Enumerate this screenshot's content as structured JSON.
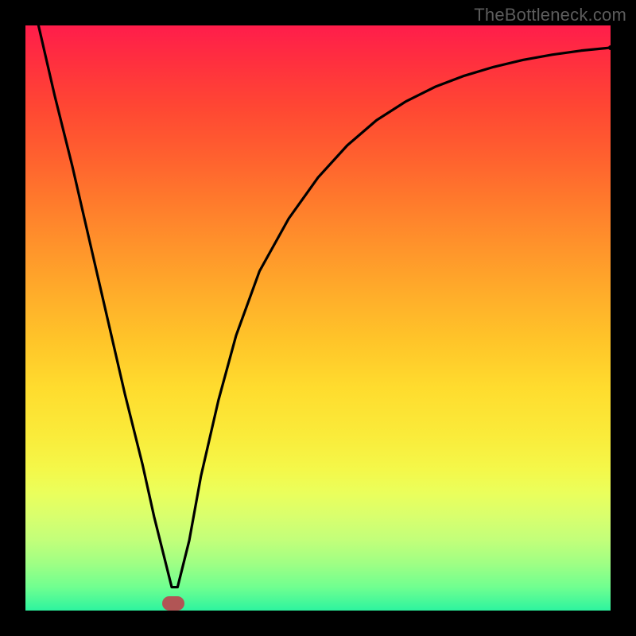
{
  "watermark": "TheBottleneck.com",
  "chart_data": {
    "type": "line",
    "title": "",
    "xlabel": "",
    "ylabel": "",
    "xlim": [
      0,
      100
    ],
    "ylim": [
      0,
      100
    ],
    "series": [
      {
        "name": "bottleneck-curve",
        "x": [
          0,
          2,
          5,
          8,
          11,
          14,
          17,
          20,
          22,
          24,
          25,
          26,
          28,
          30,
          33,
          36,
          40,
          45,
          50,
          55,
          60,
          65,
          70,
          75,
          80,
          85,
          90,
          95,
          100
        ],
        "y": [
          110,
          101,
          88,
          76,
          63,
          50,
          37,
          25,
          16,
          8,
          4,
          4,
          12,
          23,
          36,
          47,
          58,
          67,
          74,
          79.5,
          83.8,
          87,
          89.5,
          91.4,
          92.9,
          94.1,
          95.0,
          95.7,
          96.2
        ]
      }
    ],
    "marker": {
      "x": 25.3,
      "y": 0
    },
    "gradient_colors": {
      "top": "#ff1d4b",
      "mid": "#ffc529",
      "bottom": "#2df49f"
    }
  }
}
